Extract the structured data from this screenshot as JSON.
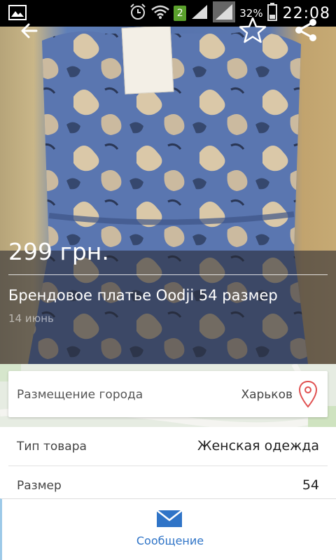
{
  "status_bar": {
    "sim_badge": "2",
    "battery_percent": "32%",
    "time": "22:08",
    "icons": [
      "gallery-icon",
      "alarm-icon",
      "wifi-icon",
      "signal-icon",
      "signal-icon-2",
      "battery-icon"
    ]
  },
  "header": {
    "back_icon": "arrow-left-icon",
    "favorite_icon": "star-outline-icon",
    "share_icon": "share-icon"
  },
  "listing": {
    "price": "299 грн.",
    "title": "Брендовое платье Oodji 54 размер",
    "date": "14 июнь"
  },
  "location": {
    "label": "Размещение города",
    "city": "Харьков",
    "icon": "map-pin-icon"
  },
  "params": [
    {
      "label": "Тип товара",
      "value": "Женская одежда"
    },
    {
      "label": "Размер",
      "value": "54"
    }
  ],
  "actions": {
    "message_label": "Сообщение",
    "message_icon": "envelope-icon"
  },
  "colors": {
    "accent": "#2f74c7",
    "pin": "#e05050",
    "status_bar": "#000000"
  }
}
